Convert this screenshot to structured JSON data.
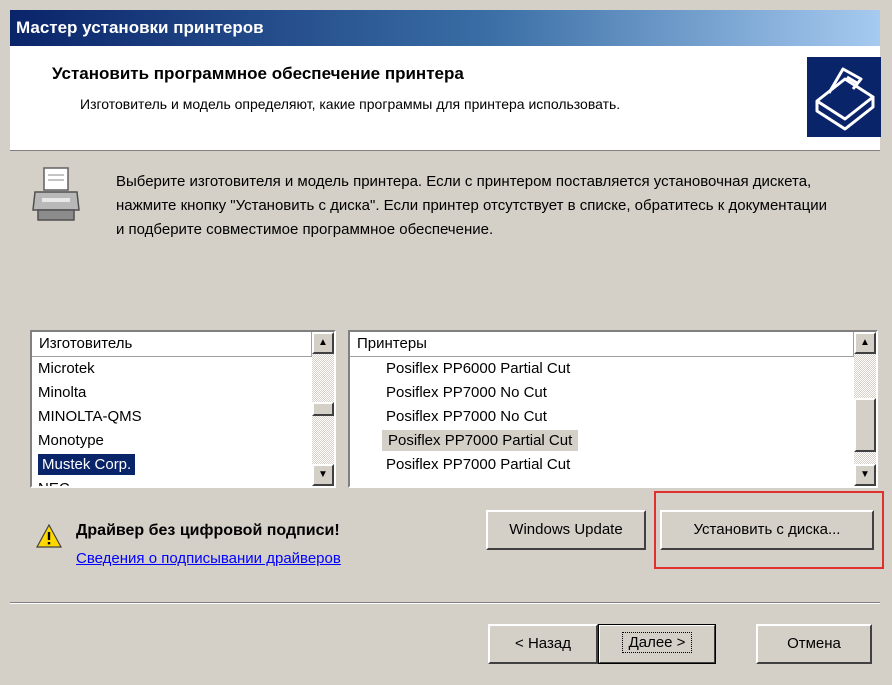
{
  "window": {
    "title": "Мастер установки принтеров"
  },
  "header": {
    "title": "Установить программное обеспечение принтера",
    "subtitle": "Изготовитель и модель определяют, какие программы для принтера использовать."
  },
  "description": "Выберите изготовителя и модель принтера. Если с принтером поставляется установочная дискета, нажмите кнопку \"Установить с диска\". Если принтер отсутствует в списке, обратитесь к документации и подберите совместимое программное обеспечение.",
  "manufacturers": {
    "header": "Изготовитель",
    "items": [
      "Microtek",
      "Minolta",
      "MINOLTA-QMS",
      "Monotype",
      "Mustek Corp.",
      "NEC"
    ],
    "selected": "Mustek Corp."
  },
  "printers": {
    "header": "Принтеры",
    "items": [
      "Posiflex PP6000 Partial Cut",
      "Posiflex PP7000 No Cut",
      "Posiflex PP7000 No Cut",
      "Posiflex PP7000 Partial Cut",
      "Posiflex PP7000 Partial Cut"
    ],
    "selected": "Posiflex PP7000 Partial Cut"
  },
  "warning": {
    "text": "Драйвер без цифровой подписи!",
    "link": "Сведения о подписывании драйверов"
  },
  "buttons": {
    "windows_update": "Windows Update",
    "have_disk": "Установить с диска...",
    "back": "< Назад",
    "next": "Далее >",
    "cancel": "Отмена"
  },
  "scroll_arrows": {
    "up": "▲",
    "down": "▼"
  },
  "icons": {
    "header": "printer-wizard-icon",
    "body": "printer-icon",
    "warning": "warning-icon"
  },
  "colors": {
    "title_bar": "#0a246a",
    "selection": "#0a246a",
    "highlight_box": "#e0302e",
    "link": "#0000ff"
  }
}
